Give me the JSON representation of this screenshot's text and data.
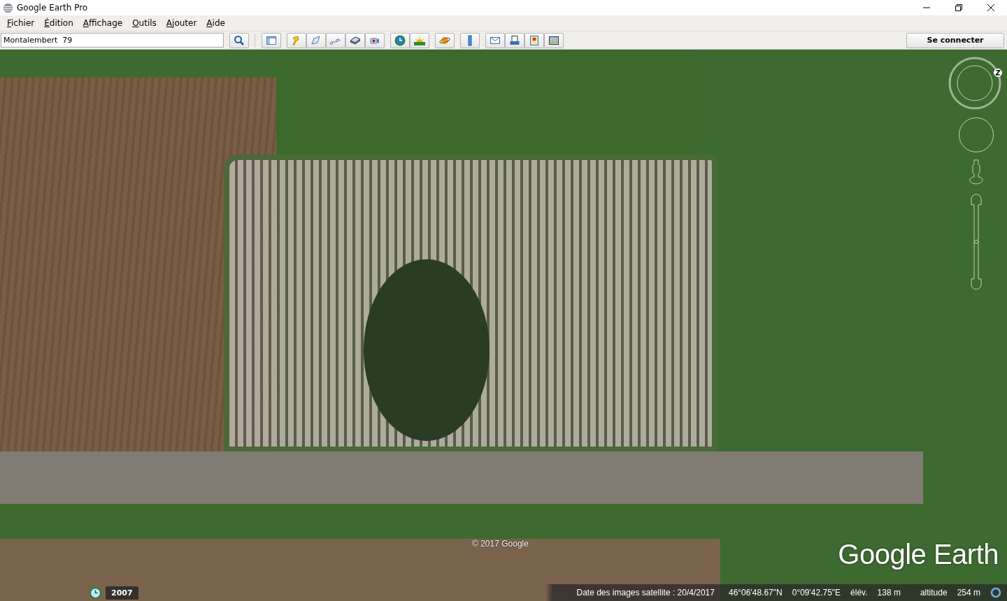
{
  "window": {
    "title": "Google Earth Pro"
  },
  "menu": [
    {
      "label": "Fichier"
    },
    {
      "label": "Édition"
    },
    {
      "label": "Affichage"
    },
    {
      "label": "Outils"
    },
    {
      "label": "Ajouter"
    },
    {
      "label": "Aide"
    }
  ],
  "search": {
    "value": "Montalembert  79"
  },
  "sign_in_button": "Se connecter",
  "zoom_slider": {
    "level": 0.5
  },
  "map": {
    "copyright": "© 2017 Google",
    "logo": "Google Earth",
    "historical_year": "2007"
  },
  "status_bar": {
    "imagery_date": "Date des images satellite : 20/4/2017",
    "latitude": "46°06'48.67\"N",
    "longitude": "0°09'42.75\"E",
    "elevation_label": "élév.",
    "elevation": "138 m",
    "altitude_label": "altitude",
    "altitude": "254 m"
  }
}
